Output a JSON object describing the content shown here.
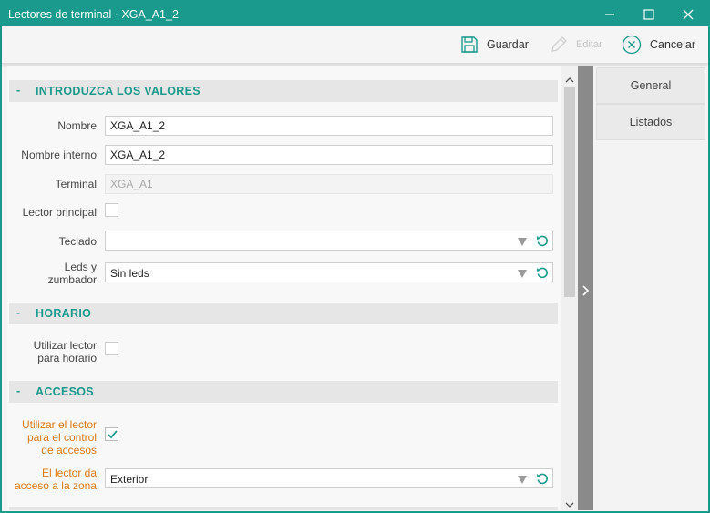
{
  "window": {
    "title": "Lectores de terminal · XGA_A1_2"
  },
  "toolbar": {
    "save_label": "Guardar",
    "edit_label": "Editar",
    "cancel_label": "Cancelar"
  },
  "sections": {
    "values": {
      "title": "INTRODUZCA LOS VALORES",
      "nombre_label": "Nombre",
      "nombre_value": "XGA_A1_2",
      "nombre_interno_label": "Nombre interno",
      "nombre_interno_value": "XGA_A1_2",
      "terminal_label": "Terminal",
      "terminal_value": "XGA_A1",
      "lector_principal_label": "Lector principal",
      "teclado_label": "Teclado",
      "teclado_value": "",
      "leds_label_1": "Leds y",
      "leds_label_2": "zumbador",
      "leds_value": "Sin leds"
    },
    "horario": {
      "title": "HORARIO",
      "utilizar_label_1": "Utilizar lector",
      "utilizar_label_2": "para horario"
    },
    "accesos": {
      "title": "ACCESOS",
      "control_label_1": "Utilizar el lector",
      "control_label_2": "para el control",
      "control_label_3": "de accesos",
      "zona_label_1": "El lector da",
      "zona_label_2": "acceso a la zona",
      "zona_value": "Exterior"
    }
  },
  "section_dash": "-",
  "right_tabs": [
    {
      "label": "General"
    },
    {
      "label": "Listados"
    }
  ],
  "colors": {
    "accent": "#1a9a8c",
    "orange_label": "#d97a17"
  }
}
